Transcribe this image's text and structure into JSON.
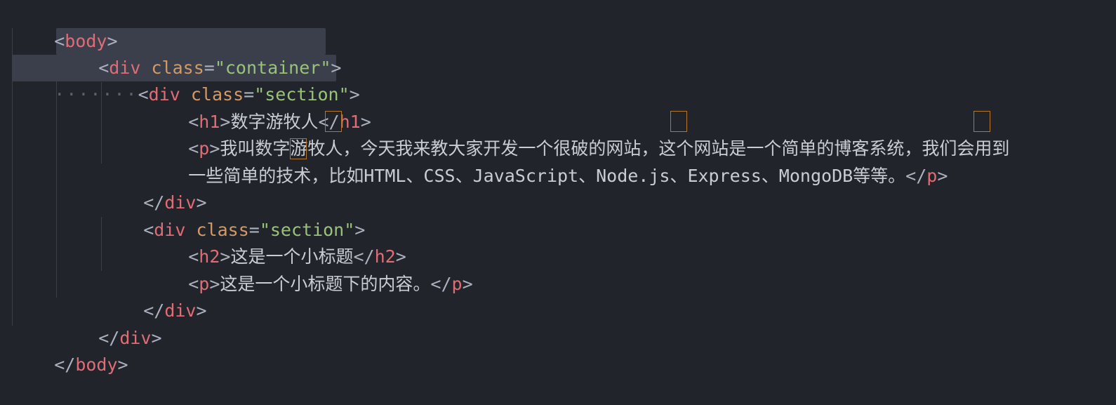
{
  "lines": [
    {
      "tag_open": "<",
      "tag": "body",
      "tag_close": ">"
    },
    {
      "lt": "<",
      "tag": "div",
      "attr": "class",
      "eq": "=",
      "val": "\"container\"",
      "gt": ">"
    },
    {
      "dots": "·······",
      "lt": "<",
      "tag": "div",
      "attr": "class",
      "eq": "=",
      "val": "\"section\"",
      "gt": ">"
    },
    {
      "lt": "<",
      "tag": "h1",
      "gt": ">",
      "text": "数字游牧人",
      "clt": "</",
      "ctag": "h1",
      "cgt": ">"
    },
    {
      "lt": "<",
      "tag": "p",
      "gt": ">",
      "text": "我叫数字游牧人，今天我来教大家开发一个很破的网站，这个网站是一个简单的博客系统，我们会用到"
    },
    {
      "text": "一些简单的技术，比如HTML、CSS、JavaScript、Node.js、Express、MongoDB等等。",
      "clt": "</",
      "ctag": "p",
      "cgt": ">"
    },
    {
      "clt": "</",
      "ctag": "div",
      "cgt": ">"
    },
    {
      "lt": "<",
      "tag": "div",
      "attr": "class",
      "eq": "=",
      "val": "\"section\"",
      "gt": ">"
    },
    {
      "lt": "<",
      "tag": "h2",
      "gt": ">",
      "text": "这是一个小标题",
      "clt": "</",
      "ctag": "h2",
      "cgt": ">"
    },
    {
      "lt": "<",
      "tag": "p",
      "gt": ">",
      "text": "这是一个小标题下的内容。",
      "clt": "</",
      "ctag": "p",
      "cgt": ">"
    },
    {
      "clt": "</",
      "ctag": "div",
      "cgt": ">"
    },
    {
      "clt": "</",
      "ctag": "div",
      "cgt": ">"
    },
    {
      "clt": "</",
      "ctag": "body",
      "cgt": ">"
    }
  ],
  "colors": {
    "background": "#21252b",
    "tag": "#e06c75",
    "attribute": "#d19a66",
    "string": "#98c379",
    "text": "#c8ccd4",
    "selection": "#3a3f4b",
    "bracket_match_box": "#b5762a"
  }
}
